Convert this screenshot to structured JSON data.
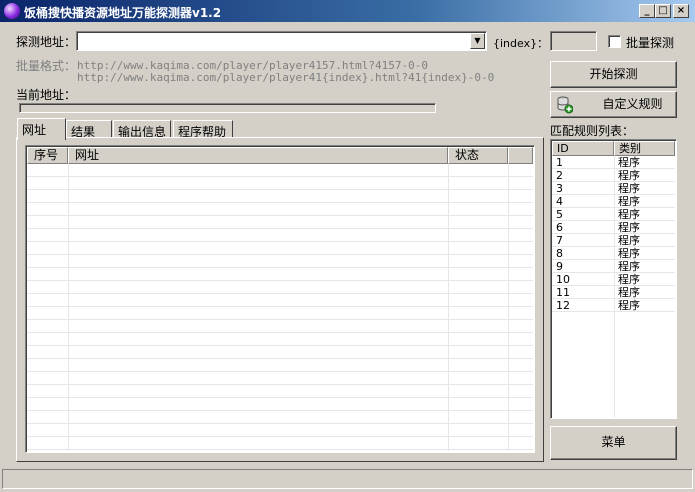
{
  "window": {
    "title": "饭桶搜快播资源地址万能探测器v1.2",
    "controls": {
      "minimize": "_",
      "maximize": "□",
      "close": "×"
    }
  },
  "probe": {
    "address_label": "探测地址：",
    "address_value": "",
    "index_label": "{index}：",
    "index_value": "",
    "batch_checkbox_label": "批量探测",
    "batch_checked": false,
    "batch_format_label": "批量格式：",
    "batch_format_line1": "http://www.kaqima.com/player/player4157.html?4157-0-0",
    "batch_format_line2": "http://www.kaqima.com/player/player41{index}.html?41{index}-0-0",
    "current_address_label": "当前地址：",
    "progress": 0
  },
  "buttons": {
    "start": "开始探测",
    "custom_rules": "自定义规则",
    "menu": "菜单"
  },
  "tabs": [
    "网址",
    "结果",
    "输出信息",
    "程序帮助"
  ],
  "url_table": {
    "columns": [
      "序号",
      "网址",
      "状态"
    ],
    "rows": []
  },
  "rules": {
    "label": "匹配规则列表：",
    "columns": [
      "ID",
      "类别"
    ],
    "rows": [
      {
        "id": "1",
        "type": "程序"
      },
      {
        "id": "2",
        "type": "程序"
      },
      {
        "id": "3",
        "type": "程序"
      },
      {
        "id": "4",
        "type": "程序"
      },
      {
        "id": "5",
        "type": "程序"
      },
      {
        "id": "6",
        "type": "程序"
      },
      {
        "id": "7",
        "type": "程序"
      },
      {
        "id": "8",
        "type": "程序"
      },
      {
        "id": "9",
        "type": "程序"
      },
      {
        "id": "10",
        "type": "程序"
      },
      {
        "id": "11",
        "type": "程序"
      },
      {
        "id": "12",
        "type": "程序"
      }
    ]
  }
}
